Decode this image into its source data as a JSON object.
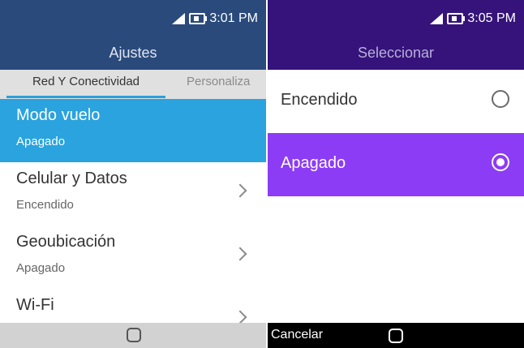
{
  "screen1": {
    "status_time": "3:01 PM",
    "title": "Ajustes",
    "tabs": [
      {
        "label": "Red Y Conectividad"
      },
      {
        "label": "Personaliza"
      }
    ],
    "items": [
      {
        "title": "Modo vuelo",
        "value": "Apagado",
        "selected": true
      },
      {
        "title": "Celular y Datos",
        "value": "Encendido"
      },
      {
        "title": "Geoubicación",
        "value": "Apagado"
      },
      {
        "title": "Wi-Fi"
      }
    ]
  },
  "screen2": {
    "status_time": "3:05 PM",
    "title": "Seleccionar",
    "options": [
      {
        "label": "Encendido",
        "selected": false
      },
      {
        "label": "Apagado",
        "selected": true
      }
    ],
    "footer": {
      "left_label": "Cancelar"
    }
  },
  "colors": {
    "screen1_header": "#2a4a7c",
    "screen1_selected": "#2aa3de",
    "screen2_header": "#35137a",
    "screen2_selected": "#8c3cf5"
  },
  "icons": [
    "signal-icon",
    "battery-icon",
    "chevron-right-icon",
    "home-icon",
    "radio-button-icon"
  ]
}
